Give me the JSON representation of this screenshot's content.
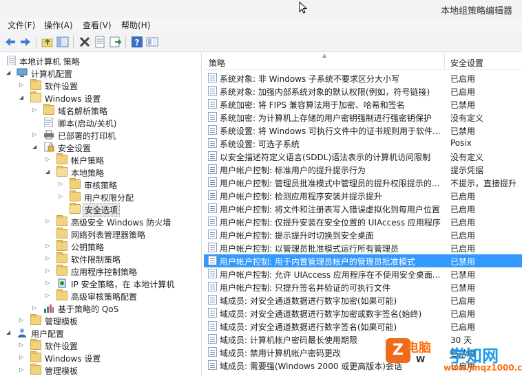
{
  "window": {
    "title": "本地组策略编辑器"
  },
  "menu": [
    "文件(F)",
    "操作(A)",
    "查看(V)",
    "帮助(H)"
  ],
  "toolbar": {
    "icons": [
      "back-arrow-icon",
      "forward-arrow-icon",
      "up-folder-icon",
      "show-hide-tree-icon",
      "delete-icon",
      "properties-icon",
      "export-list-icon",
      "help-icon",
      "extended-view-icon"
    ]
  },
  "tree": {
    "root": "本地计算机 策略",
    "computer_config": "计算机配置",
    "software_settings": "软件设置",
    "windows_settings": "Windows 设置",
    "dns_policy": "域名解析策略",
    "scripts": "脚本(启动/关机)",
    "printers": "已部署的打印机",
    "security_settings": "安全设置",
    "account_policy": "帐户策略",
    "local_policy": "本地策略",
    "audit_policy": "审核策略",
    "user_rights": "用户权限分配",
    "security_options": "安全选项",
    "firewall": "高级安全 Windows 防火墙",
    "network_list": "网络列表管理器策略",
    "public_key": "公钥策略",
    "software_restriction": "软件限制策略",
    "app_control": "应用程序控制策略",
    "ip_security": "IP 安全策略，在 本地计算机",
    "advanced_audit": "高级审核策略配置",
    "qos": "基于策略的 QoS",
    "admin_templates": "管理模板",
    "user_config": "用户配置",
    "u_software": "软件设置",
    "u_windows": "Windows 设置",
    "u_admin": "管理模板"
  },
  "list": {
    "col_policy": "策略",
    "col_setting": "安全设置",
    "rows": [
      {
        "name": "系统对象: 非 Windows 子系统不要求区分大小写",
        "value": "已启用"
      },
      {
        "name": "系统对象: 加强内部系统对象的默认权限(例如，符号链接)",
        "value": "已启用"
      },
      {
        "name": "系统加密: 将 FIPS 兼容算法用于加密、哈希和签名",
        "value": "已禁用"
      },
      {
        "name": "系统加密: 为计算机上存储的用户密钥强制进行强密钥保护",
        "value": "没有定义"
      },
      {
        "name": "系统设置: 将 Windows 可执行文件中的证书规则用于软件...",
        "value": "已禁用"
      },
      {
        "name": "系统设置: 可选子系统",
        "value": "Posix"
      },
      {
        "name": "以安全描述符定义语言(SDDL)语法表示的计算机访问限制",
        "value": "没有定义"
      },
      {
        "name": "用户帐户控制: 标准用户的提升提示行为",
        "value": "提示凭据"
      },
      {
        "name": "用户帐户控制: 管理员批准模式中管理员的提升权限提示的...",
        "value": "不提示，直接提升"
      },
      {
        "name": "用户帐户控制: 检测应用程序安装并提示提升",
        "value": "已启用"
      },
      {
        "name": "用户帐户控制: 将文件和注册表写入错误虚拟化到每用户位置",
        "value": "已启用"
      },
      {
        "name": "用户帐户控制: 仅提升安装在安全位置的 UIAccess 应用程序",
        "value": "已启用"
      },
      {
        "name": "用户帐户控制: 提示提升时切换到安全桌面",
        "value": "已启用"
      },
      {
        "name": "用户帐户控制: 以管理员批准模式运行所有管理员",
        "value": "已启用"
      },
      {
        "name": "用户帐户控制: 用于内置管理员帐户的管理员批准模式",
        "value": "已禁用"
      },
      {
        "name": "用户帐户控制: 允许 UIAccess 应用程序在不使用安全桌面...",
        "value": "已禁用"
      },
      {
        "name": "用户帐户控制: 只提升签名并验证的可执行文件",
        "value": "已禁用"
      },
      {
        "name": "域成员: 对安全通道数据进行数字加密(如果可能)",
        "value": "已启用"
      },
      {
        "name": "域成员: 对安全通道数据进行数字加密或数字签名(始终)",
        "value": "已启用"
      },
      {
        "name": "域成员: 对安全通道数据进行数字签名(如果可能)",
        "value": "已启用"
      },
      {
        "name": "域成员: 计算机帐户密码最长使用期限",
        "value": "30 天"
      },
      {
        "name": "域成员: 禁用计算机帐户密码更改",
        "value": "已禁用"
      },
      {
        "name": "域成员: 需要强(Windows 2000 或更高版本)会话",
        "value": "已启用"
      }
    ]
  },
  "watermark": {
    "logo": "Z",
    "brand": "电脑",
    "sub": "W",
    "title": "学知网",
    "url": "www.jmqz1000.com"
  }
}
